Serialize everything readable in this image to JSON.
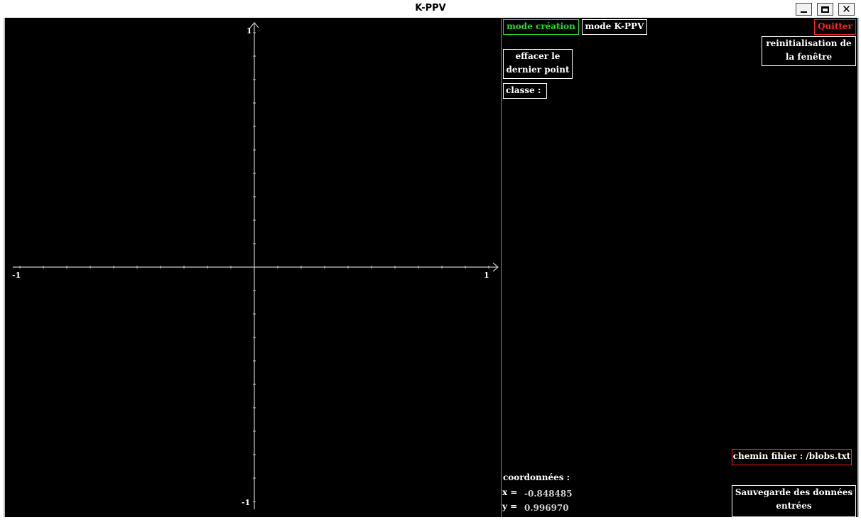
{
  "window": {
    "title": "K-PPV",
    "minimize_icon": "minimize-icon",
    "maximize_icon": "maximize-icon",
    "close_icon": "close-icon"
  },
  "plot": {
    "x_min_label": "-1",
    "x_max_label": "1",
    "y_min_label": "-1",
    "y_max_label": "1",
    "axis_color": "#c8c8c8"
  },
  "panel": {
    "mode_creation": "mode création",
    "mode_kppv": "mode K-PPV",
    "quit": "Quitter",
    "reset": "reinitialisation de la fenêtre",
    "erase_last": "effacer le dernier point",
    "class_label": "classe :",
    "file_path": "chemin fihier : /blobs.txt",
    "coords_title": "coordonnées :",
    "x_label": "x =",
    "x_value": "-0.848485",
    "y_label": "y =",
    "y_value": "0.996970",
    "save": "Sauvegarde des données entrées",
    "colors": {
      "active_mode": "#22dd22",
      "quit": "#ff2222",
      "file_path_border": "#ff2222"
    }
  }
}
